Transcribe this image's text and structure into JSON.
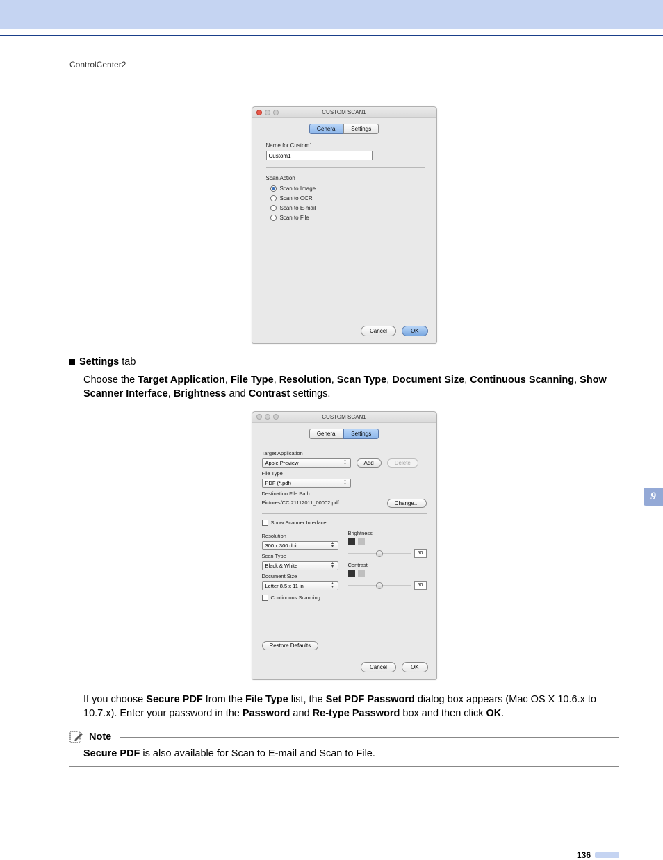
{
  "header": {
    "title": "ControlCenter2"
  },
  "side_tab": "9",
  "page_number": "136",
  "dialog1": {
    "window_title": "CUSTOM SCAN1",
    "tabs": {
      "general": "General",
      "settings": "Settings",
      "active": "general"
    },
    "name_label": "Name for Custom1",
    "name_value": "Custom1",
    "scan_action_label": "Scan Action",
    "radios": {
      "image": "Scan to Image",
      "ocr": "Scan to OCR",
      "email": "Scan to E-mail",
      "file": "Scan to File"
    },
    "buttons": {
      "cancel": "Cancel",
      "ok": "OK"
    }
  },
  "section1": {
    "heading_label": "Settings",
    "heading_suffix": " tab"
  },
  "para1": {
    "pre": "Choose the ",
    "b1": "Target Application",
    "c1": ", ",
    "b2": "File Type",
    "c2": ", ",
    "b3": "Resolution",
    "c3": ", ",
    "b4": "Scan Type",
    "c4": ", ",
    "b5": "Document Size",
    "c5": ", ",
    "b6": "Continuous Scanning",
    "c6": ", ",
    "b7": "Show Scanner Interface",
    "c7": ", ",
    "b8": "Brightness",
    "c8": " and ",
    "b9": "Contrast",
    "post": " settings."
  },
  "dialog2": {
    "window_title": "CUSTOM SCAN1",
    "tabs": {
      "general": "General",
      "settings": "Settings",
      "active": "settings"
    },
    "target_app_label": "Target Application",
    "target_app_value": "Apple Preview",
    "add_btn": "Add",
    "delete_btn": "Delete",
    "file_type_label": "File Type",
    "file_type_value": "PDF (*.pdf)",
    "dest_label": "Destination File Path",
    "dest_value": "Pictures/CCI21112011_00002.pdf",
    "change_btn": "Change...",
    "show_scanner_label": "Show Scanner Interface",
    "resolution_label": "Resolution",
    "resolution_value": "300 x 300 dpi",
    "scan_type_label": "Scan Type",
    "scan_type_value": "Black & White",
    "doc_size_label": "Document Size",
    "doc_size_value": "Letter 8.5 x 11 in",
    "continuous_label": "Continuous Scanning",
    "brightness_label": "Brightness",
    "brightness_value": "50",
    "contrast_label": "Contrast",
    "contrast_value": "50",
    "restore_btn": "Restore Defaults",
    "buttons": {
      "cancel": "Cancel",
      "ok": "OK"
    }
  },
  "para2": {
    "pre": "If you choose ",
    "b1": "Secure PDF",
    "c1": " from the ",
    "b2": "File Type",
    "c2": " list, the ",
    "b3": "Set PDF Password",
    "c3": " dialog box appears (Mac OS X 10.6.x to 10.7.x). Enter your password in the ",
    "b4": "Password",
    "c4": " and ",
    "b5": "Re-type Password",
    "c5": " box and then click ",
    "b6": "OK",
    "post": "."
  },
  "note": {
    "title": "Note",
    "body_b": "Secure PDF",
    "body_rest": " is also available for Scan to E-mail and Scan to File."
  }
}
